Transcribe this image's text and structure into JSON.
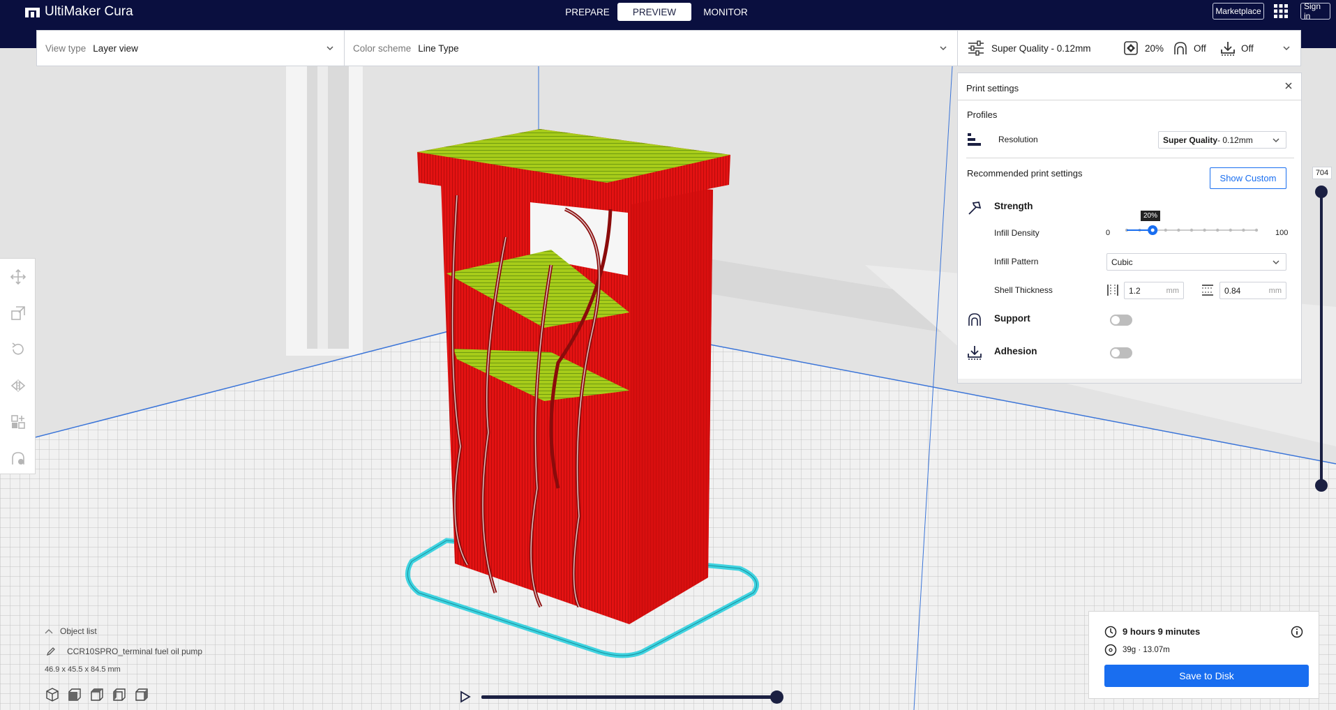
{
  "app": {
    "name": "UltiMaker Cura"
  },
  "header": {
    "stages": [
      "PREPARE",
      "PREVIEW",
      "MONITOR"
    ],
    "active_stage": "PREVIEW",
    "marketplace_label": "Marketplace",
    "signin_label": "Sign in"
  },
  "toolbar": {
    "view_type_label": "View type",
    "view_type_value": "Layer view",
    "color_scheme_label": "Color scheme",
    "color_scheme_value": "Line Type",
    "profile_summary": "Super Quality - 0.12mm",
    "infill_summary": "20%",
    "support_summary": "Off",
    "adhesion_summary": "Off"
  },
  "print_settings": {
    "title": "Print settings",
    "profiles_heading": "Profiles",
    "resolution_label": "Resolution",
    "resolution_value_bold": "Super Quality",
    "resolution_value_rest": " - 0.12mm",
    "recommended_heading": "Recommended print settings",
    "show_custom_label": "Show Custom",
    "strength_label": "Strength",
    "infill_density_label": "Infill Density",
    "infill_density_min": "0",
    "infill_density_max": "100",
    "infill_density_tooltip": "20%",
    "infill_density_value": 20,
    "infill_pattern_label": "Infill Pattern",
    "infill_pattern_value": "Cubic",
    "shell_thickness_label": "Shell Thickness",
    "wall_thickness_value": "1.2",
    "topbottom_thickness_value": "0.84",
    "unit_mm": "mm",
    "support_label": "Support",
    "support_enabled": false,
    "adhesion_label": "Adhesion",
    "adhesion_enabled": false
  },
  "layer_slider": {
    "current_layer": "704"
  },
  "object_list": {
    "toggle_label": "Object list",
    "object_name": "CCR10SPRO_terminal fuel oil pump",
    "dimensions": "46.9 x 45.5 x 84.5 mm"
  },
  "print_info": {
    "time": "9 hours 9 minutes",
    "material": "39g · 13.07m",
    "save_label": "Save to Disk"
  },
  "colors": {
    "header_bg": "#0a0f3f",
    "accent_blue": "#196ef0",
    "model_red": "#e31212",
    "top_green": "#a7cc1a",
    "skirt_cyan": "#3fd3e0"
  }
}
